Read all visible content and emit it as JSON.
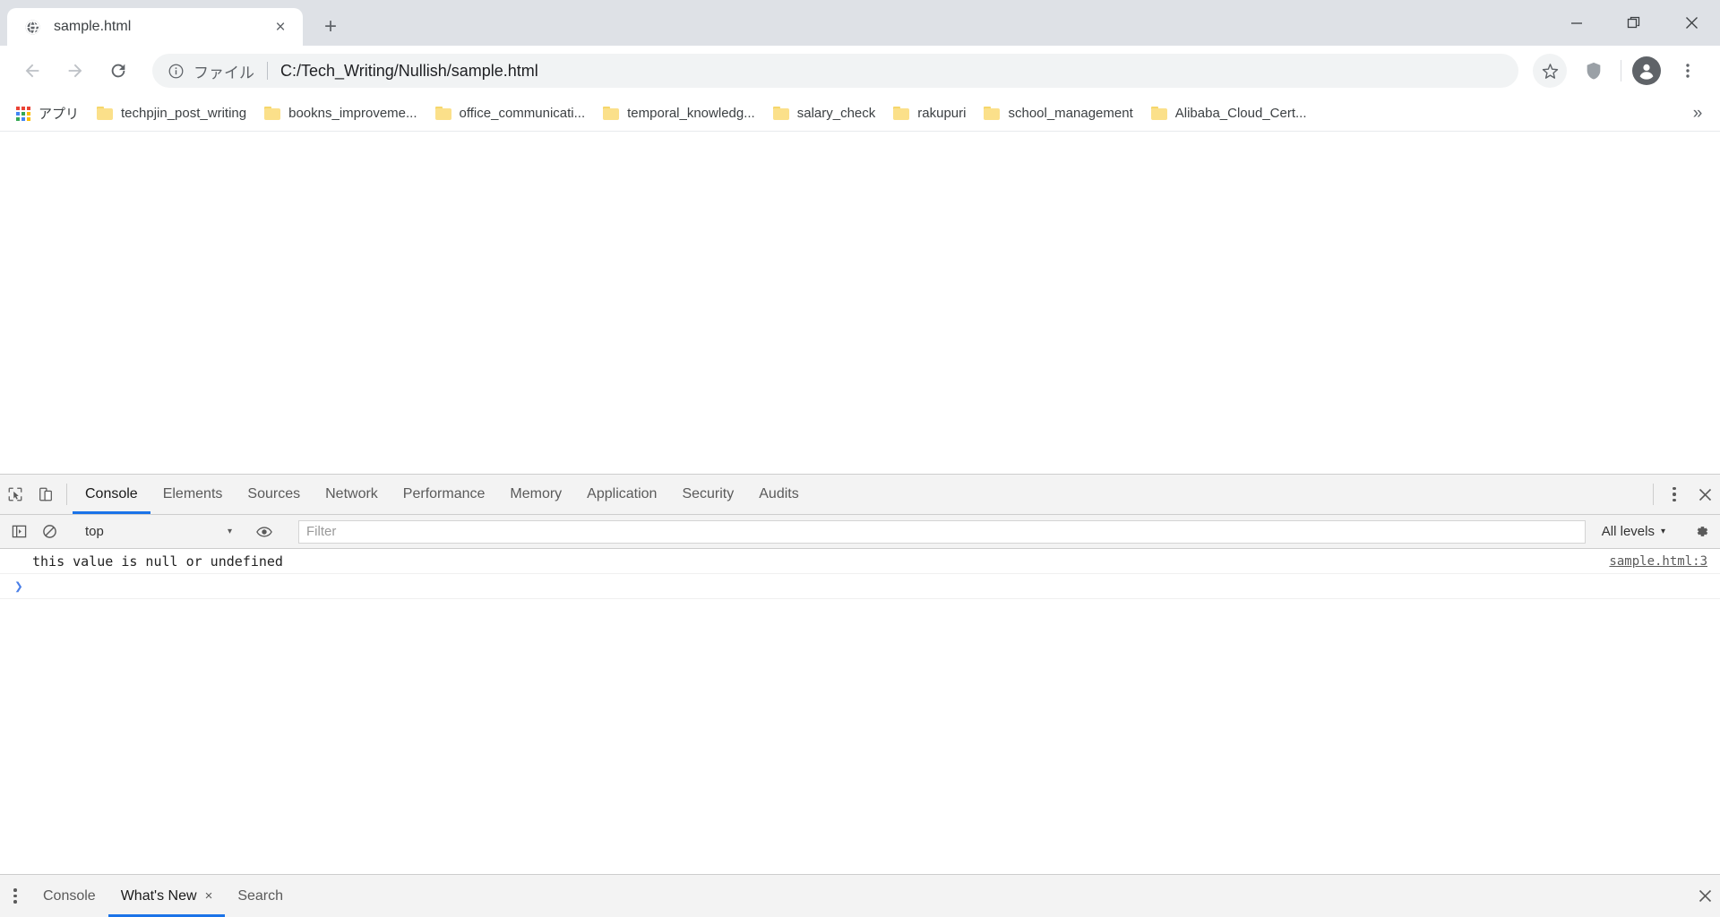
{
  "window": {
    "minimize_label": "Minimize",
    "maximize_label": "Maximize",
    "close_label": "Close"
  },
  "tab": {
    "title": "sample.html",
    "close_label": "×",
    "newtab_label": "+"
  },
  "toolbar": {
    "back_label": "←",
    "forward_label": "→",
    "reload_label": "⟳",
    "omnibox": {
      "scheme_label": "ファイル",
      "url": "C:/Tech_Writing/Nullish/sample.html",
      "separator": "|"
    }
  },
  "bookmarks": {
    "apps_label": "アプリ",
    "overflow_label": "»",
    "items": [
      {
        "label": "techpjin_post_writing"
      },
      {
        "label": "bookns_improveme..."
      },
      {
        "label": "office_communicati..."
      },
      {
        "label": "temporal_knowledg..."
      },
      {
        "label": "salary_check"
      },
      {
        "label": "rakupuri"
      },
      {
        "label": "school_management"
      },
      {
        "label": "Alibaba_Cloud_Cert..."
      }
    ]
  },
  "devtools": {
    "tabs": [
      {
        "label": "Console",
        "active": true
      },
      {
        "label": "Elements",
        "active": false
      },
      {
        "label": "Sources",
        "active": false
      },
      {
        "label": "Network",
        "active": false
      },
      {
        "label": "Performance",
        "active": false
      },
      {
        "label": "Memory",
        "active": false
      },
      {
        "label": "Application",
        "active": false
      },
      {
        "label": "Security",
        "active": false
      },
      {
        "label": "Audits",
        "active": false
      }
    ],
    "close_label": "×",
    "console_toolbar": {
      "clear_label": "Clear console",
      "context": "top",
      "context_caret": "▾",
      "filter_placeholder": "Filter",
      "filter_value": "",
      "levels_label": "All levels",
      "levels_caret": "▾"
    },
    "console_messages": [
      {
        "text": "this value is null or undefined",
        "source": "sample.html:3"
      }
    ],
    "prompt_symbol": "❯"
  },
  "drawer": {
    "tabs": [
      {
        "label": "Console",
        "active": false,
        "closable": false
      },
      {
        "label": "What's New",
        "active": true,
        "closable": true
      },
      {
        "label": "Search",
        "active": false,
        "closable": false
      }
    ],
    "close_x": "×",
    "drawer_close_label": "×"
  },
  "colors": {
    "accent": "#1a73e8",
    "tabstrip_bg": "#dee1e6",
    "devtools_bg": "#f3f3f3",
    "folder_yellow": "#fbe08a"
  }
}
